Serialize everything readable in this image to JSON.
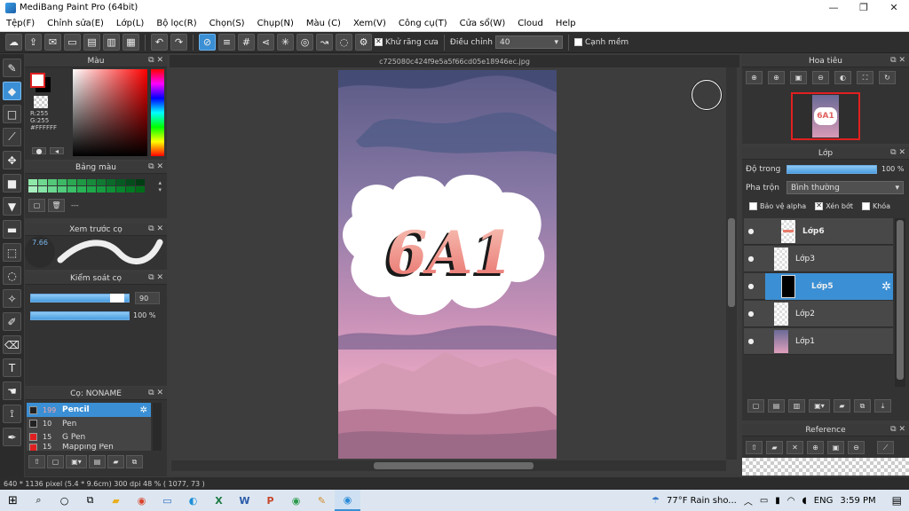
{
  "window": {
    "title": "MediBang Paint Pro (64bit)"
  },
  "menu": [
    "Tệp(F)",
    "Chỉnh sửa(E)",
    "Lớp(L)",
    "Bộ lọc(R)",
    "Chọn(S)",
    "Chụp(N)",
    "Màu (C)",
    "Xem(V)",
    "Công cụ(T)",
    "Cửa sổ(W)",
    "Cloud",
    "Help"
  ],
  "toolbar": {
    "antialias_label": "Khử răng cưa",
    "adjust_label": "Điều chỉnh",
    "adjust_value": "40",
    "soft_edge_label": "Cạnh mềm"
  },
  "color_panel": {
    "title": "Màu",
    "r": "R:255",
    "g": "G:255",
    "hex": "#FFFFFF",
    "fg_color": "#FFFFFF",
    "bg_color": "#000000"
  },
  "palette_panel": {
    "title": "Bảng màu",
    "name": "---",
    "swatches": [
      "#8ee8a8",
      "#6fd890",
      "#52c878",
      "#3db865",
      "#2aa852",
      "#1f9845",
      "#178a3b",
      "#107a32",
      "#0a6a2a",
      "#065b22",
      "#034c1b",
      "#013d14",
      "#a8f0c0",
      "#86e4a6",
      "#6ad890",
      "#50cc7c",
      "#3ac068",
      "#28b456",
      "#1ea84a",
      "#169c40",
      "#0f9036",
      "#08842c",
      "#037822",
      "#006c1a"
    ]
  },
  "brush_preview": {
    "title": "Xem trước cọ",
    "size": "7.66"
  },
  "brush_control": {
    "title": "Kiểm soát cọ",
    "size_value": "90",
    "opacity_value": "100 %"
  },
  "brush_list": {
    "title": "Cọ: NONAME",
    "items": [
      {
        "size": "199",
        "name": "Pencil",
        "color": "#222222",
        "selected": true
      },
      {
        "size": "10",
        "name": "Pen",
        "color": "#222222",
        "selected": false
      },
      {
        "size": "15",
        "name": "G Pen",
        "color": "#e02020",
        "selected": false
      },
      {
        "size": "15",
        "name": "Mapping Pen",
        "color": "#e02020",
        "selected": false
      }
    ]
  },
  "document": {
    "filename": "c725080c424f9e5a5f66cd05e18946ec.jpg",
    "artwork_text": "6A1"
  },
  "navigator": {
    "title": "Hoa tiêu"
  },
  "layers_panel": {
    "title": "Lớp",
    "opacity_label": "Độ trong",
    "opacity_value": "100 %",
    "blend_label": "Pha trộn",
    "blend_value": "Bình thường",
    "protect_alpha_label": "Bảo vệ alpha",
    "clipping_label": "Xén bớt",
    "lock_label": "Khóa",
    "layers": [
      {
        "name": "Lớp6",
        "selected": false
      },
      {
        "name": "Lớp3",
        "selected": false
      },
      {
        "name": "Lớp5",
        "selected": true
      },
      {
        "name": "Lớp2",
        "selected": false
      },
      {
        "name": "Lớp1",
        "selected": false
      }
    ]
  },
  "reference_panel": {
    "title": "Reference"
  },
  "status": {
    "text": "640 * 1136 pixel  (5.4 * 9.6cm)  300 dpi  48 %  ( 1077, 73 )"
  },
  "taskbar": {
    "weather": "77°F  Rain sho...",
    "lang": "ENG",
    "time": "3:59 PM"
  }
}
